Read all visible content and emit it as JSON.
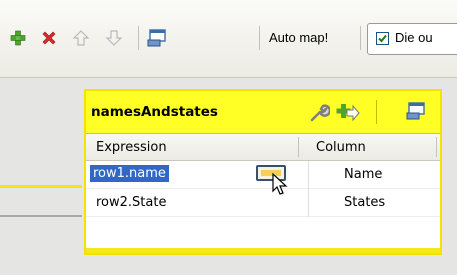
{
  "toolbar": {
    "auto_map_label": "Auto map!",
    "die_label": "Die ou",
    "die_checked": true,
    "icons": [
      "add-icon",
      "delete-icon",
      "move-up-icon",
      "move-down-icon",
      "window-icon"
    ]
  },
  "panel": {
    "title": "namesAndstates",
    "header_expression": "Expression",
    "header_column": "Column",
    "rows": [
      {
        "expression": "row1.name",
        "column": "Name",
        "selected": true
      },
      {
        "expression": "row2.State",
        "column": "States",
        "selected": false
      }
    ],
    "icons": [
      "wrench-icon",
      "add-output-icon",
      "window-icon"
    ]
  },
  "colors": {
    "title_bar": "#ffff26",
    "selection": "#3168c6",
    "link_active": "#f4e70e"
  }
}
